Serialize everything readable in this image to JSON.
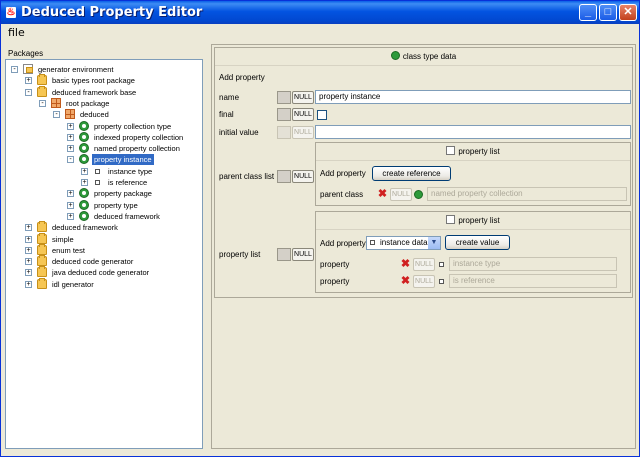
{
  "window": {
    "title": "Deduced Property Editor"
  },
  "menu": {
    "file": "file"
  },
  "left": {
    "title": "Packages",
    "tree": [
      {
        "label": "generator environment",
        "icon": "root",
        "indent": 0,
        "toggle": "-"
      },
      {
        "label": "basic types root package",
        "icon": "package",
        "indent": 1,
        "toggle": "+"
      },
      {
        "label": "deduced framework base",
        "icon": "package",
        "indent": 1,
        "toggle": "-"
      },
      {
        "label": "root package",
        "icon": "grid",
        "indent": 2,
        "toggle": "-"
      },
      {
        "label": "deduced",
        "icon": "grid",
        "indent": 3,
        "toggle": "-"
      },
      {
        "label": "property collection type",
        "icon": "class",
        "indent": 4,
        "toggle": "+"
      },
      {
        "label": "indexed property collection",
        "icon": "class",
        "indent": 4,
        "toggle": "+"
      },
      {
        "label": "named property collection",
        "icon": "class",
        "indent": 4,
        "toggle": "+"
      },
      {
        "label": "property instance",
        "icon": "class",
        "indent": 4,
        "toggle": "-",
        "selected": true
      },
      {
        "label": "instance type",
        "icon": "square",
        "indent": 5,
        "toggle": "+"
      },
      {
        "label": "is reference",
        "icon": "square",
        "indent": 5,
        "toggle": "+"
      },
      {
        "label": "property package",
        "icon": "class",
        "indent": 4,
        "toggle": "+"
      },
      {
        "label": "property type",
        "icon": "class",
        "indent": 4,
        "toggle": "+"
      },
      {
        "label": "deduced framework",
        "icon": "class",
        "indent": 4,
        "toggle": "+"
      },
      {
        "label": "deduced framework",
        "icon": "package",
        "indent": 1,
        "toggle": "+"
      },
      {
        "label": "simple",
        "icon": "package",
        "indent": 1,
        "toggle": "+"
      },
      {
        "label": "enum test",
        "icon": "package",
        "indent": 1,
        "toggle": "+"
      },
      {
        "label": "deduced code generator",
        "icon": "package",
        "indent": 1,
        "toggle": "+"
      },
      {
        "label": "java deduced code generator",
        "icon": "package",
        "indent": 1,
        "toggle": "+"
      },
      {
        "label": "idl generator",
        "icon": "package",
        "indent": 1,
        "toggle": "+"
      }
    ]
  },
  "editor": {
    "header": "class type data",
    "add_property": "Add property",
    "null_label": "NULL",
    "name_label": "name",
    "name_value": "property instance",
    "final_label": "final",
    "initial_value_label": "initial value",
    "parent_class_list_label": "parent class list",
    "parent_list": {
      "header": "property list",
      "add_property": "Add property",
      "create_reference": "create reference",
      "parent_class_label": "parent class",
      "parent_class_value": "named property collection"
    },
    "property_list_label": "property list",
    "prop_list": {
      "header": "property list",
      "add_property": "Add property",
      "combo_value": "instance data",
      "create_value": "create value",
      "rows": [
        {
          "label": "property",
          "value": "instance type"
        },
        {
          "label": "property",
          "value": "is reference"
        }
      ]
    }
  }
}
